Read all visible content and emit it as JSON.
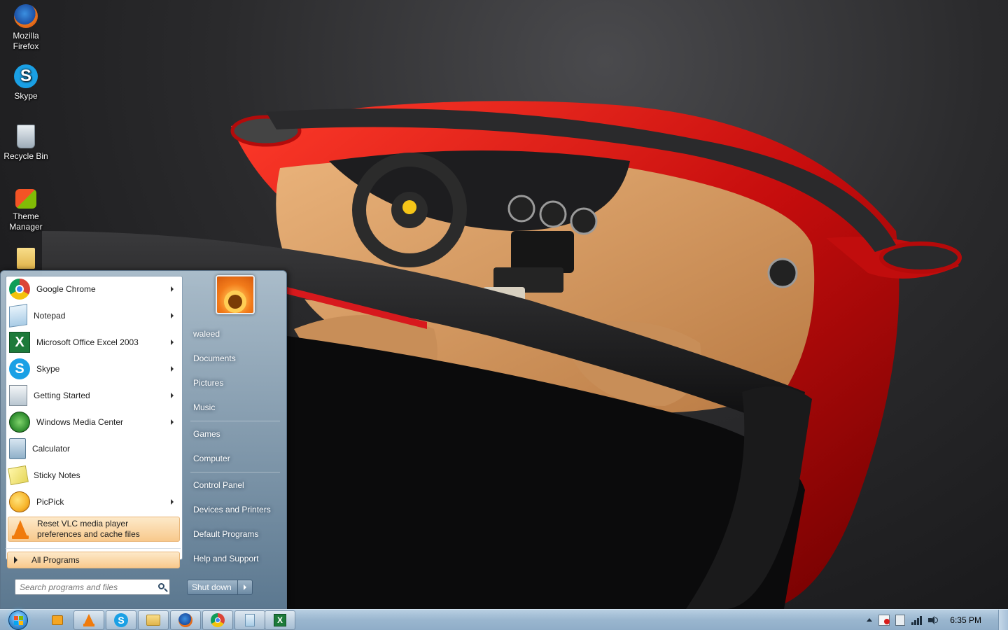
{
  "desktop": {
    "icons": [
      {
        "label": "Mozilla Firefox",
        "icon": "firefox-icon"
      },
      {
        "label": "Skype",
        "icon": "skype-icon"
      },
      {
        "label": "Recycle Bin",
        "icon": "recycle-bin-icon"
      },
      {
        "label": "Theme Manager",
        "icon": "theme-manager-icon"
      }
    ]
  },
  "start_menu": {
    "programs": [
      {
        "label": "Google Chrome",
        "icon": "chrome-icon",
        "submenu": true
      },
      {
        "label": "Notepad",
        "icon": "notepad-icon",
        "submenu": true
      },
      {
        "label": "Microsoft Office Excel 2003",
        "icon": "excel-icon",
        "submenu": true
      },
      {
        "label": "Skype",
        "icon": "skype-icon",
        "submenu": true
      },
      {
        "label": "Getting Started",
        "icon": "getting-started-icon",
        "submenu": true
      },
      {
        "label": "Windows Media Center",
        "icon": "media-center-icon",
        "submenu": true
      },
      {
        "label": "Calculator",
        "icon": "calculator-icon",
        "submenu": false
      },
      {
        "label": "Sticky Notes",
        "icon": "sticky-notes-icon",
        "submenu": false
      },
      {
        "label": "PicPick",
        "icon": "picpick-icon",
        "submenu": true
      },
      {
        "label": "Reset VLC media player preferences and cache files",
        "label_line1": "Reset VLC media player",
        "label_line2": "preferences and cache files",
        "icon": "vlc-icon",
        "submenu": false
      }
    ],
    "all_programs": "All Programs",
    "search_placeholder": "Search programs and files",
    "user_name": "waleed",
    "right_links": [
      "Documents",
      "Pictures",
      "Music",
      "Games",
      "Computer",
      "Control Panel",
      "Devices and Printers",
      "Default Programs",
      "Help and Support"
    ],
    "shutdown_label": "Shut down"
  },
  "taskbar": {
    "pinned": [
      "media-player-icon",
      "vlc-icon",
      "skype-icon",
      "explorer-icon",
      "firefox-icon",
      "chrome-icon",
      "notepad-icon",
      "excel-icon"
    ],
    "tray_icons": [
      "show-hidden-icons-arrow",
      "action-center-icon",
      "network-adapter-icon",
      "signal-icon",
      "volume-icon"
    ],
    "clock": "6:35 PM"
  }
}
